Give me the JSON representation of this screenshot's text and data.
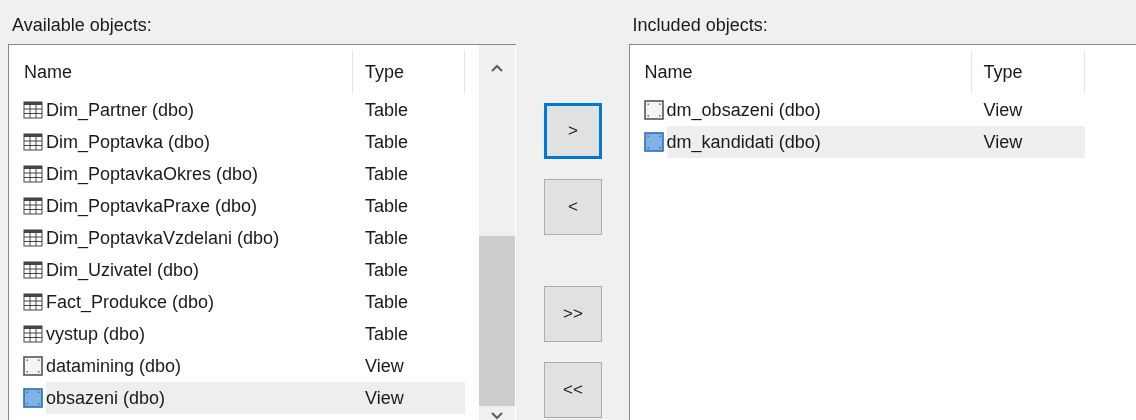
{
  "available": {
    "label": "Available objects:",
    "columns": [
      "Name",
      "Type"
    ],
    "items": [
      {
        "name": "Dim_Partner (dbo)",
        "type": "Table",
        "kind": "table",
        "selected": false
      },
      {
        "name": "Dim_Poptavka (dbo)",
        "type": "Table",
        "kind": "table",
        "selected": false
      },
      {
        "name": "Dim_PoptavkaOkres (dbo)",
        "type": "Table",
        "kind": "table",
        "selected": false
      },
      {
        "name": "Dim_PoptavkaPraxe (dbo)",
        "type": "Table",
        "kind": "table",
        "selected": false
      },
      {
        "name": "Dim_PoptavkaVzdelani (dbo)",
        "type": "Table",
        "kind": "table",
        "selected": false
      },
      {
        "name": "Dim_Uzivatel (dbo)",
        "type": "Table",
        "kind": "table",
        "selected": false
      },
      {
        "name": "Fact_Produkce (dbo)",
        "type": "Table",
        "kind": "table",
        "selected": false
      },
      {
        "name": "vystup (dbo)",
        "type": "Table",
        "kind": "table",
        "selected": false
      },
      {
        "name": "datamining (dbo)",
        "type": "View",
        "kind": "view",
        "selected": false
      },
      {
        "name": "obsazeni (dbo)",
        "type": "View",
        "kind": "view",
        "selected": true
      }
    ]
  },
  "buttons": [
    {
      "label": ">",
      "focused": true
    },
    {
      "label": "<",
      "focused": false
    },
    {
      "label": ">>",
      "focused": false
    },
    {
      "label": "<<",
      "focused": false
    }
  ],
  "included": {
    "label": "Included objects:",
    "columns": [
      "Name",
      "Type"
    ],
    "items": [
      {
        "name": "dm_obsazeni (dbo)",
        "type": "View",
        "kind": "view",
        "selected": false
      },
      {
        "name": "dm_kandidati (dbo)",
        "type": "View",
        "kind": "view",
        "selected": true
      }
    ]
  }
}
